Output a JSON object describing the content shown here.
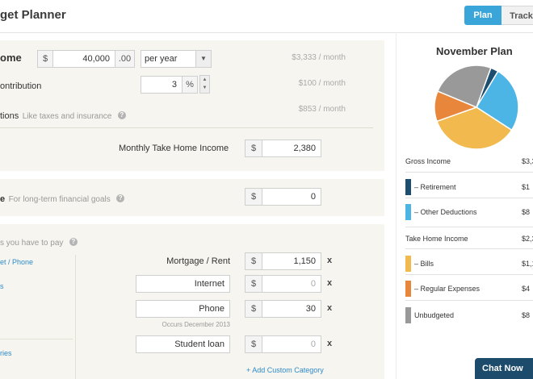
{
  "app": {
    "title": "get Planner"
  },
  "view_toggle": {
    "plan_label": "Plan",
    "track_label": "Track"
  },
  "income": {
    "label": "ome",
    "currency": "$",
    "amount": "40,000",
    "cents": ".00",
    "period": "per year",
    "monthly": "$3,333",
    "per_month": "/ month"
  },
  "retirement": {
    "label": "ontribution",
    "percent": "3",
    "percent_sign": "%",
    "monthly": "$100",
    "per_month": "/ month"
  },
  "deductions": {
    "label": "tions",
    "hint": "Like taxes and insurance",
    "monthly": "$853",
    "per_month": "/ month"
  },
  "take_home": {
    "label": "Monthly Take Home Income",
    "currency": "$",
    "value": "2,380"
  },
  "savings": {
    "label": "e",
    "hint": "For long-term financial goals",
    "currency": "$",
    "value": "0"
  },
  "bills": {
    "hint": "s you have to pay",
    "side_links": [
      "et / Phone",
      "s",
      "ries"
    ],
    "rows": [
      {
        "name": "Mortgage / Rent",
        "currency": "$",
        "value": "1,150",
        "remove": "x"
      },
      {
        "name": "Internet",
        "currency": "$",
        "value": "0",
        "remove": "x"
      },
      {
        "name": "Phone",
        "currency": "$",
        "value": "30",
        "remove": "x"
      },
      {
        "name": "Student loan",
        "currency": "$",
        "value": "0",
        "remove": "x"
      }
    ],
    "phone_note": "Occurs December 2013",
    "add_label": "+ Add Custom Category"
  },
  "plan_chart": {
    "title": "November Plan",
    "slices": [
      {
        "name": "Retirement",
        "value": 100,
        "color": "#1d4e70"
      },
      {
        "name": "Other Deductions",
        "value": 853,
        "color": "#4db4e6"
      },
      {
        "name": "Bills",
        "value": 1180,
        "color": "#f1b94e"
      },
      {
        "name": "Regular Expenses",
        "value": 390,
        "color": "#e8873c"
      },
      {
        "name": "Unbudgeted",
        "value": 810,
        "color": "#999999"
      }
    ]
  },
  "legend": {
    "gross_label": "Gross Income",
    "gross_value": "$3,3",
    "retirement_label": "– Retirement",
    "retirement_value": "$1",
    "deductions_label": "– Other Deductions",
    "deductions_value": "$8",
    "take_home_label": "Take Home Income",
    "take_home_value": "$2,3",
    "bills_label": "– Bills",
    "bills_value": "$1,1",
    "regular_label": "– Regular Expenses",
    "regular_value": "$4",
    "unbudgeted_label": "Unbudgeted",
    "unbudgeted_value": "$8"
  },
  "chat": {
    "label": "Chat Now"
  },
  "colors": {
    "accent": "#3aa5d8",
    "panel": "#f6f5ef",
    "link": "#2e8bc9"
  }
}
